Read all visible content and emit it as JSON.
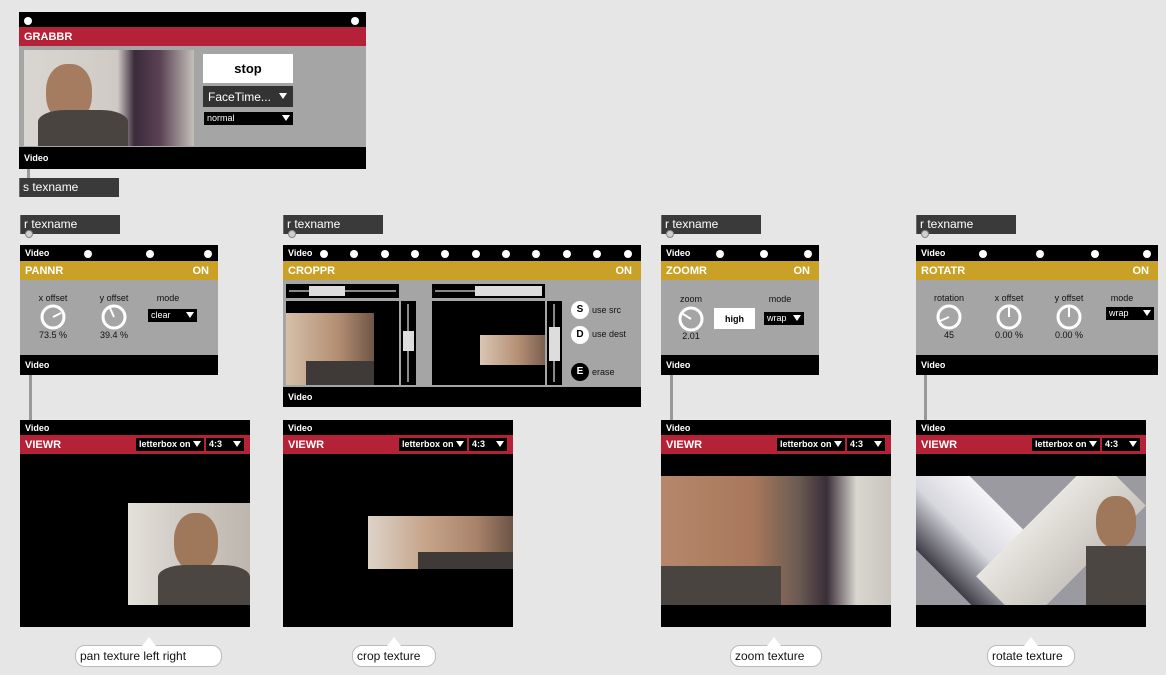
{
  "grabbr": {
    "title": "GRABBR",
    "stop_label": "stop",
    "device_menu": "FaceTime...",
    "mode_menu": "normal",
    "footer": "Video"
  },
  "send_box": "s texname",
  "receive_box": "r texname",
  "pannr": {
    "inlet_label": "Video",
    "title": "PANNR",
    "on_label": "ON",
    "x_offset_label": "x offset",
    "x_offset_value": "73.5 %",
    "y_offset_label": "y offset",
    "y_offset_value": "39.4 %",
    "mode_label": "mode",
    "mode_menu": "clear",
    "footer": "Video"
  },
  "croppr": {
    "inlet_label": "Video",
    "title": "CROPPR",
    "on_label": "ON",
    "use_src_btn": "S",
    "use_src_label": "use src",
    "use_dest_btn": "D",
    "use_dest_label": "use dest",
    "erase_btn": "E",
    "erase_label": "erase",
    "footer": "Video"
  },
  "zoomr": {
    "inlet_label": "Video",
    "title": "ZOOMR",
    "on_label": "ON",
    "zoom_label": "zoom",
    "zoom_value": "2.01",
    "quality_button": "high",
    "mode_label": "mode",
    "mode_menu": "wrap",
    "footer": "Video"
  },
  "rotatr": {
    "inlet_label": "Video",
    "title": "ROTATR",
    "on_label": "ON",
    "rotation_label": "rotation",
    "rotation_value": "45",
    "x_offset_label": "x offset",
    "x_offset_value": "0.00 %",
    "y_offset_label": "y offset",
    "y_offset_value": "0.00 %",
    "mode_label": "mode",
    "mode_menu": "wrap",
    "footer": "Video"
  },
  "viewr": {
    "inlet_label": "Video",
    "title": "VIEWR",
    "letterbox_menu": "letterbox on",
    "aspect_menu": "4:3"
  },
  "comments": {
    "pan": "pan texture  left right",
    "crop": "crop texture",
    "zoom": "zoom texture",
    "rotate": "rotate texture"
  },
  "colors": {
    "background": "#e6e6e6",
    "red_title": "#b52238",
    "gold_title": "#c9a127",
    "module_body": "#a5a5a5"
  },
  "icons": [
    "dial-icon",
    "dropdown-arrow-icon",
    "inlet-dot-icon",
    "outlet-dot-icon"
  ]
}
